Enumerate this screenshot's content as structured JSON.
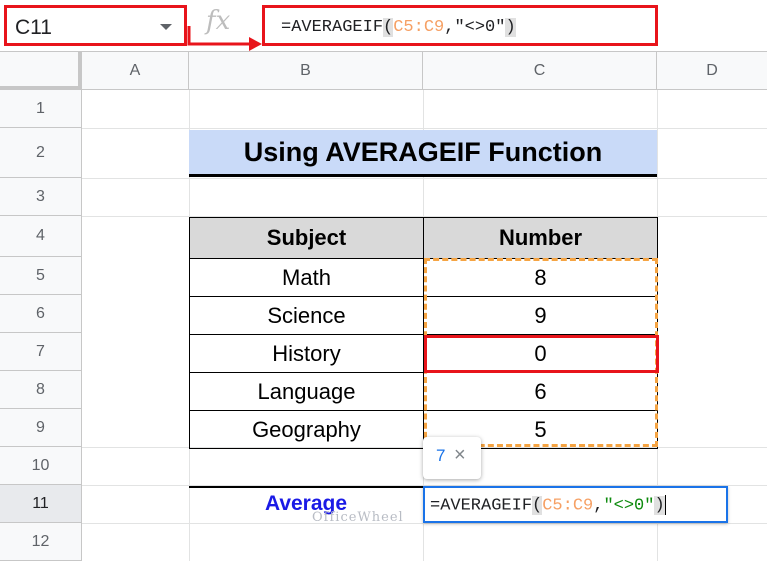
{
  "formula_bar": {
    "name_box": "C11",
    "fx_label": "fx",
    "formula": {
      "prefix": "=AVERAGEIF",
      "open_paren": "(",
      "range": "C5:C9",
      "comma": ",",
      "criterion": "\"<>0\"",
      "close_paren": ")"
    }
  },
  "columns": [
    "A",
    "B",
    "C",
    "D"
  ],
  "rows": [
    "1",
    "2",
    "3",
    "4",
    "5",
    "6",
    "7",
    "8",
    "9",
    "10",
    "11",
    "12"
  ],
  "title": "Using AVERAGEIF Function",
  "table": {
    "headers": [
      "Subject",
      "Number"
    ],
    "rows": [
      {
        "subject": "Math",
        "number": "8"
      },
      {
        "subject": "Science",
        "number": "9"
      },
      {
        "subject": "History",
        "number": "0"
      },
      {
        "subject": "Language",
        "number": "6"
      },
      {
        "subject": "Geography",
        "number": "5"
      }
    ]
  },
  "average_label": "Average",
  "tooltip": {
    "value": "7",
    "close": "×"
  },
  "watermark": "OfficeWheel",
  "colors": {
    "highlight_red": "#e8141b",
    "range_orange": "#f5a443",
    "title_fill": "#c9daf8",
    "average_blue": "#1a1ae6"
  }
}
